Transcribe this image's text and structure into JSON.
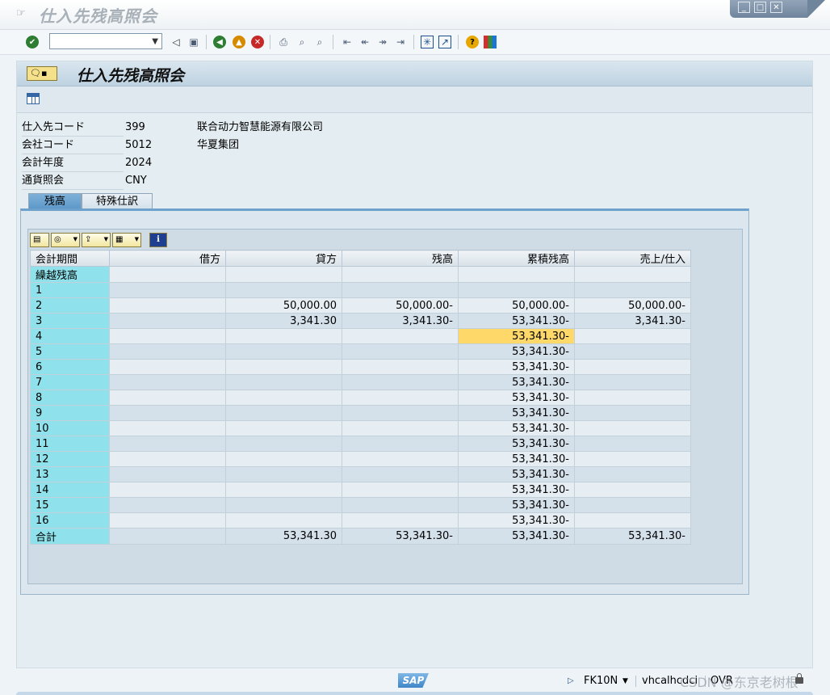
{
  "window": {
    "title": "仕入先残高照会"
  },
  "toolbar": {
    "command_value": ""
  },
  "header": {
    "title": "仕入先残高照会"
  },
  "fields": [
    {
      "label": "仕入先コード",
      "value": "399",
      "text": "联合动力智慧能源有限公司"
    },
    {
      "label": "会社コード",
      "value": "5012",
      "text": "华夏集团"
    },
    {
      "label": "会計年度",
      "value": "2024",
      "text": ""
    },
    {
      "label": "通貨照会",
      "value": "CNY",
      "text": ""
    }
  ],
  "tabs": [
    {
      "label": "残高",
      "active": true
    },
    {
      "label": "特殊仕訳",
      "active": false
    }
  ],
  "table": {
    "columns": [
      "会計期間",
      "借方",
      "貸方",
      "残高",
      "累積残高",
      "売上/仕入"
    ],
    "rows": [
      [
        "繰越残高",
        "",
        "",
        "",
        "",
        ""
      ],
      [
        "1",
        "",
        "",
        "",
        "",
        ""
      ],
      [
        "2",
        "",
        "50,000.00",
        "50,000.00-",
        "50,000.00-",
        "50,000.00-"
      ],
      [
        "3",
        "",
        "3,341.30",
        "3,341.30-",
        "53,341.30-",
        "3,341.30-"
      ],
      [
        "4",
        "",
        "",
        "",
        "53,341.30-",
        ""
      ],
      [
        "5",
        "",
        "",
        "",
        "53,341.30-",
        ""
      ],
      [
        "6",
        "",
        "",
        "",
        "53,341.30-",
        ""
      ],
      [
        "7",
        "",
        "",
        "",
        "53,341.30-",
        ""
      ],
      [
        "8",
        "",
        "",
        "",
        "53,341.30-",
        ""
      ],
      [
        "9",
        "",
        "",
        "",
        "53,341.30-",
        ""
      ],
      [
        "10",
        "",
        "",
        "",
        "53,341.30-",
        ""
      ],
      [
        "11",
        "",
        "",
        "",
        "53,341.30-",
        ""
      ],
      [
        "12",
        "",
        "",
        "",
        "53,341.30-",
        ""
      ],
      [
        "13",
        "",
        "",
        "",
        "53,341.30-",
        ""
      ],
      [
        "14",
        "",
        "",
        "",
        "53,341.30-",
        ""
      ],
      [
        "15",
        "",
        "",
        "",
        "53,341.30-",
        ""
      ],
      [
        "16",
        "",
        "",
        "",
        "53,341.30-",
        ""
      ],
      [
        "合計",
        "",
        "53,341.30",
        "53,341.30-",
        "53,341.30-",
        "53,341.30-"
      ]
    ],
    "highlight": {
      "row": 4,
      "col": 4
    }
  },
  "status": {
    "logo": "SAP",
    "transaction": "FK10N",
    "server": "vhcalhcdci",
    "mode": "OVR",
    "watermark": "CSDN @东京老树根"
  },
  "colors": {
    "key_column": "#8fe2ec",
    "highlight_cell": "#ffd86a",
    "active_tab": "#5c97c8"
  }
}
